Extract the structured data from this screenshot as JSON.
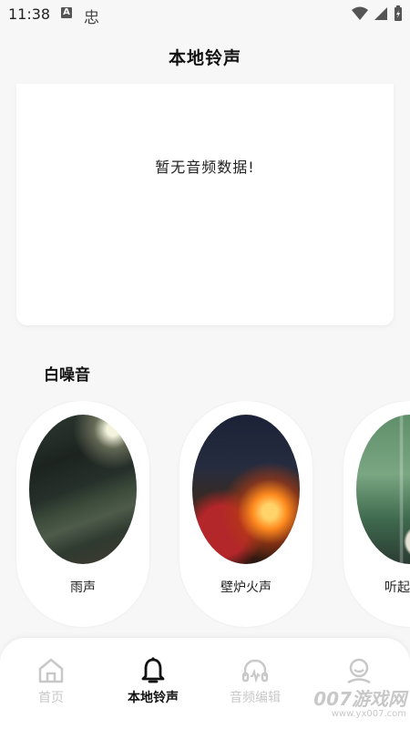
{
  "status": {
    "time": "11:38",
    "badge": "A",
    "app_glyph": "忠"
  },
  "header": {
    "title": "本地铃声"
  },
  "audio": {
    "empty_text": "暂无音频数据!"
  },
  "white_noise": {
    "title": "白噪音",
    "items": [
      {
        "label": "雨声",
        "image": "rain-street-night"
      },
      {
        "label": "壁炉火声",
        "image": "fireplace-cabin"
      },
      {
        "label": "听起来放",
        "image": "rainy-window-cup"
      }
    ]
  },
  "nav": {
    "items": [
      {
        "label": "首页",
        "icon": "home-icon",
        "active": false
      },
      {
        "label": "本地铃声",
        "icon": "bell-icon",
        "active": true
      },
      {
        "label": "音频编辑",
        "icon": "headphones-icon",
        "active": false
      },
      {
        "label": "",
        "icon": "user-icon",
        "active": false
      }
    ]
  },
  "watermark": {
    "big": "007游戏网",
    "small": "www.yx007.com"
  },
  "colors": {
    "active": "#111111",
    "inactive": "#c8c8c8",
    "background": "#f7f7f7"
  }
}
